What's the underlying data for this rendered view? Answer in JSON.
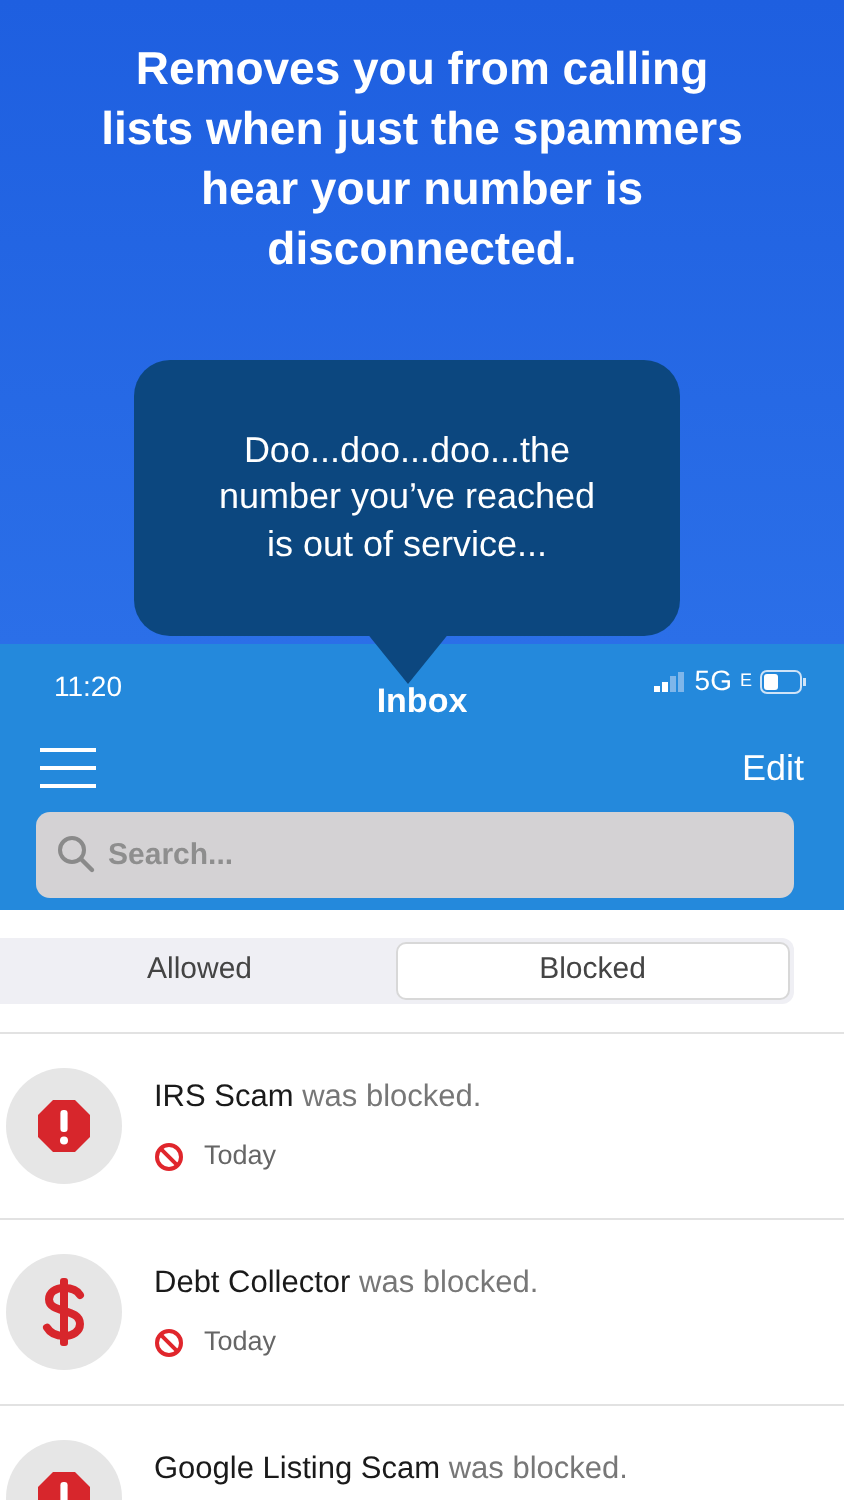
{
  "headline": "Removes you from calling lists when just the spammers hear your number is disconnected.",
  "bubble": {
    "text": "Doo...doo...doo...the number you’ve reached is out of service..."
  },
  "status_bar": {
    "time": "11:20",
    "network": "5G",
    "network_suffix": "E"
  },
  "title": "Inbox",
  "nav": {
    "edit": "Edit"
  },
  "search": {
    "placeholder": "Search..."
  },
  "segments": [
    {
      "label": "Allowed",
      "selected": false
    },
    {
      "label": "Blocked",
      "selected": true
    }
  ],
  "messages": [
    {
      "kind": "warning",
      "name": "IRS Scam",
      "suffix": "was blocked.",
      "time": "Today"
    },
    {
      "kind": "dollar",
      "name": "Debt Collector",
      "suffix": "was blocked.",
      "time": "Today"
    },
    {
      "kind": "warning",
      "name": "Google Listing Scam",
      "suffix": "was blocked."
    }
  ]
}
